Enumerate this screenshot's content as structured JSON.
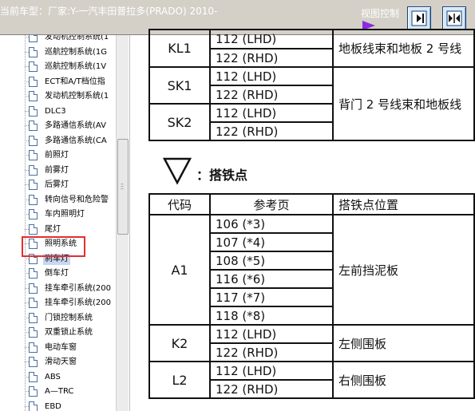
{
  "header": {
    "title": "当前车型：厂家:Y-一汽丰田普拉多(PRADO) 2010-",
    "view_control_label": "视图控制",
    "colors": {
      "toolbar_bg": "#d4d0c8",
      "play_accent": "#8a2be2",
      "selection_border": "#e03030"
    }
  },
  "sidebar": {
    "items": [
      {
        "label": "发动机控制系统(1"
      },
      {
        "label": "巡航控制系统(1G"
      },
      {
        "label": "巡航控制系统(1V"
      },
      {
        "label": "ECT和A/T档位指"
      },
      {
        "label": "发动机控制系统(1"
      },
      {
        "label": "DLC3"
      },
      {
        "label": "多路通信系统(AV"
      },
      {
        "label": "多路通信系统(CA"
      },
      {
        "label": "前照灯"
      },
      {
        "label": "前雾灯"
      },
      {
        "label": "后雾灯"
      },
      {
        "label": "转向信号和危险警"
      },
      {
        "label": "车内照明灯"
      },
      {
        "label": "尾灯"
      },
      {
        "label": "照明系统"
      },
      {
        "label": "刹车灯"
      },
      {
        "label": "倒车灯"
      },
      {
        "label": "挂车牵引系统(200"
      },
      {
        "label": "挂车牵引系统(200"
      },
      {
        "label": "门锁控制系统"
      },
      {
        "label": "双重锁止系统"
      },
      {
        "label": "电动车窗"
      },
      {
        "label": "滑动天窗"
      },
      {
        "label": "ABS"
      },
      {
        "label": "A—TRC"
      },
      {
        "label": "EBD"
      },
      {
        "label": "VSC"
      }
    ],
    "selected_index": 15
  },
  "doc": {
    "top_table": {
      "rows": [
        {
          "code": "KL1",
          "refs": [
            "112 (LHD)",
            "122 (RHD)"
          ],
          "location": "地板线束和地板 2 号线"
        },
        {
          "code": "SK1",
          "refs": [
            "112 (LHD)",
            "122 (RHD)"
          ],
          "location": "背门 2 号线束和地板线"
        },
        {
          "code": "SK2",
          "refs": [
            "112 (LHD)",
            "122 (RHD)"
          ],
          "location": ""
        }
      ]
    },
    "ground_section_title": "：搭铁点",
    "ground_icon": "ground-triangle-icon",
    "ground_table": {
      "headers": {
        "code": "代码",
        "ref": "参考页",
        "location": "搭铁点位置"
      },
      "rows": [
        {
          "code": "A1",
          "refs": [
            "106 (*3)",
            "107 (*4)",
            "108 (*5)",
            "116 (*6)",
            "117 (*7)",
            "118 (*8)"
          ],
          "location": "左前挡泥板"
        },
        {
          "code": "K2",
          "refs": [
            "112 (LHD)",
            "122 (RHD)"
          ],
          "location": "左侧围板"
        },
        {
          "code": "L2",
          "refs": [
            "112 (LHD)",
            "122 (RHD)"
          ],
          "location": "右侧围板"
        }
      ]
    }
  }
}
